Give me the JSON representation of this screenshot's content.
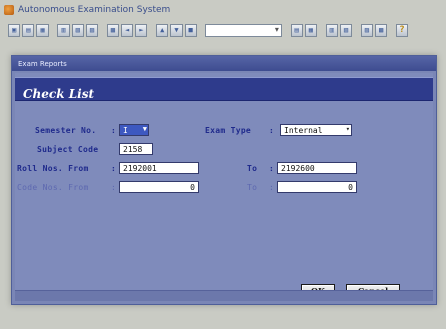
{
  "app": {
    "title": "Autonomous Examination System"
  },
  "toolbar": {
    "buttons_a": [
      "▣",
      "▤",
      "▦",
      "▥",
      "▧",
      "▨",
      "▩"
    ],
    "buttons_b": [
      "◄",
      "►",
      "▲",
      "▼",
      "■"
    ],
    "buttons_c": [
      "▤",
      "▦",
      "▥",
      "▧",
      "▨",
      "▩"
    ],
    "help": "?"
  },
  "dialog": {
    "caption": "Exam Reports",
    "header": "Check List",
    "semester_label": "Semester No.",
    "semester_value": "I",
    "exam_type_label": "Exam Type",
    "exam_type_value": "Internal",
    "subject_code_label": "Subject Code",
    "subject_code_value": "2158",
    "roll_from_label": "Roll Nos. From",
    "roll_from_value": "2192001",
    "roll_to_label": "To",
    "roll_to_value": "2192600",
    "code_from_label": "Code Nos. From",
    "code_from_value": "0",
    "code_to_label": "To",
    "code_to_value": "0",
    "colon": ":",
    "ok_label": "OK",
    "cancel_label": "Cancel"
  }
}
